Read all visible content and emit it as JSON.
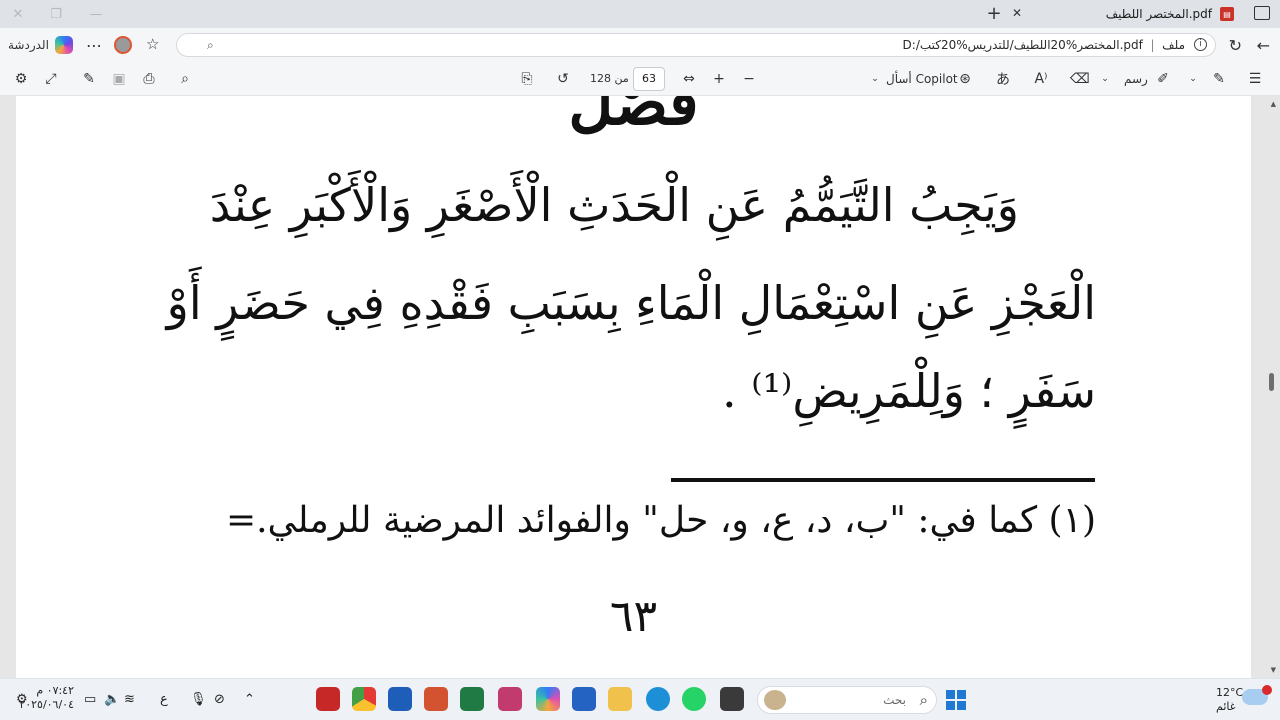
{
  "browser": {
    "tab": {
      "title": "المختصر اللطيف.pdf"
    },
    "address": {
      "prefix": "ملف",
      "url": "D:/المختصر%20اللطيف/للتدريس%20كتب.pdf"
    },
    "copilot_label": "الدردشة"
  },
  "pdf_toolbar": {
    "current_page": "63",
    "total_pages_text": "من 128",
    "ask_copilot_label": "أسأل Copilot",
    "draw_label": "رسم"
  },
  "document": {
    "heading": "فَصْلٌ",
    "lines": [
      "وَيَجِبُ التَّيَمُّمُ عَنِ الْحَدَثِ الْأَصْغَرِ وَالْأَكْبَرِ عِنْدَ",
      "الْعَجْزِ عَنِ اسْتِعْمَالِ الْمَاءِ بِسَبَبِ فَقْدِهِ فِي حَضَرٍ أَوْ",
      "سَفَرٍ ؛ وَلِلْمَرِيضِ⁽¹⁾ ."
    ],
    "footnote": "(١) كما في: \"ب، د، ع، و، حل\" والفوائد المرضية للرملي.=",
    "page_number": "٦٣"
  },
  "taskbar": {
    "search_placeholder": "بحث",
    "time": "٠٧:٤٢ م",
    "date": "٢٠٢٥/٠٦/٠٤",
    "weather_temp": "12°C",
    "weather_desc": "غائم",
    "lang": "ع"
  },
  "colors": {
    "accent": "#1f78d1",
    "pdf_icon": "#c9332a"
  }
}
